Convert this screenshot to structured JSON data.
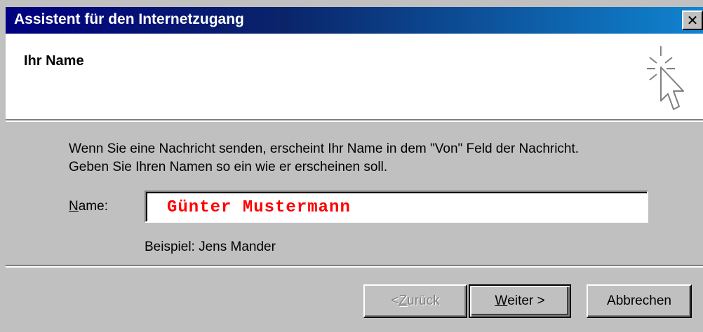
{
  "window": {
    "title": "Assistent für den Internetzugang",
    "close_symbol": "✕"
  },
  "header": {
    "title": "Ihr Name",
    "icon": "wizard-cursor-sparkle-icon"
  },
  "body": {
    "line1": "Wenn Sie eine Nachricht senden, erscheint Ihr Name in dem \"Von\" Feld der Nachricht.",
    "line2": "Geben Sie Ihren Namen so ein wie er erscheinen soll."
  },
  "form": {
    "name_label_mnemonic": "N",
    "name_label_rest": "ame:",
    "name_value": "Günter Mustermann",
    "example": "Beispiel: Jens Mander"
  },
  "buttons": {
    "back_prefix": "< ",
    "back_mnemonic": "Z",
    "back_rest": "urück",
    "next_mnemonic": "W",
    "next_rest": "eiter >",
    "cancel": "Abbrechen"
  },
  "colors": {
    "title_bar_start": "#000080",
    "title_bar_end": "#1084d0",
    "name_text": "#ff0000",
    "face": "#c0c0c0"
  }
}
